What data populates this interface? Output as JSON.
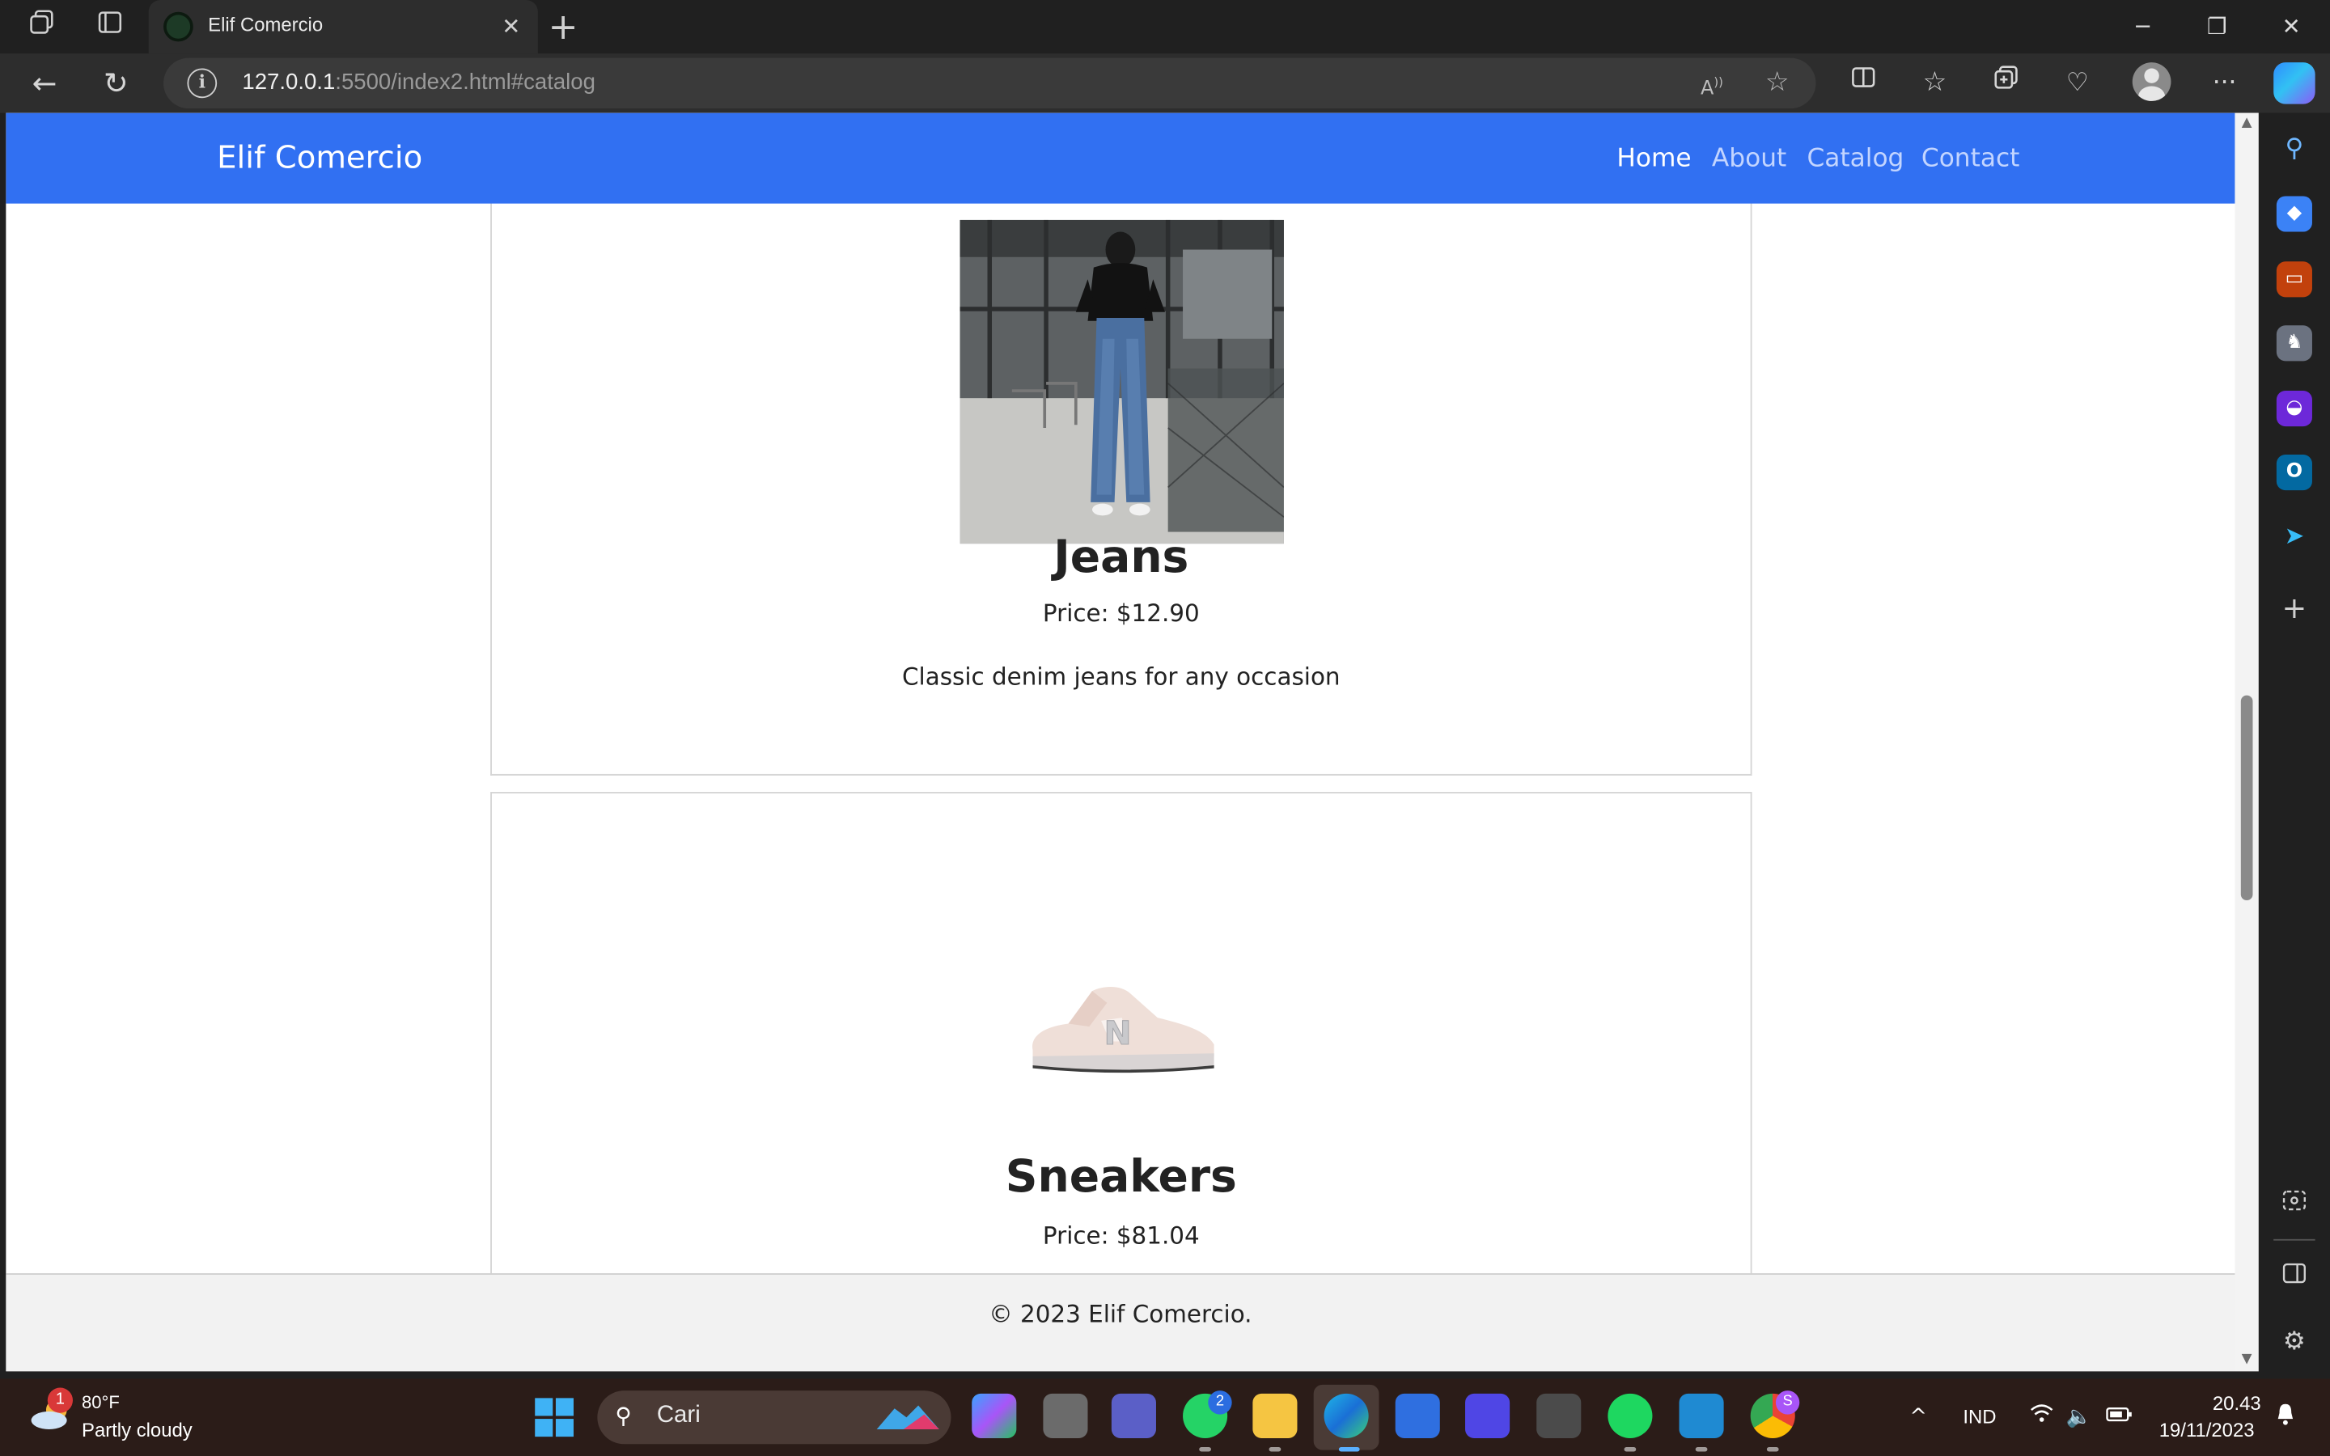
{
  "browser": {
    "tab_title": "Elif Comercio",
    "tab_close_icon": "✕",
    "new_tab_icon": "+",
    "url_host": "127.0.0.1",
    "url_rest": ":5500/index2.html#catalog",
    "window_controls": {
      "minimize": "─",
      "restore": "❐",
      "close": "✕"
    },
    "toolbar_icons": {
      "back": "←",
      "refresh": "↻",
      "info": "i",
      "more": "···"
    }
  },
  "site": {
    "brand": "Elif Comercio",
    "nav": [
      "Home",
      "About",
      "Catalog",
      "Contact"
    ],
    "active_nav": "Home",
    "products": [
      {
        "name": "Jeans",
        "price": "Price: $12.90",
        "description": "Classic denim jeans for any occasion"
      },
      {
        "name": "Sneakers",
        "price": "Price: $81.04"
      }
    ],
    "footer": "© 2023 Elif Comercio."
  },
  "taskbar": {
    "weather_badge": "1",
    "weather_temp": "80°F",
    "weather_condition": "Partly cloudy",
    "search_placeholder": "Cari",
    "whatsapp_badge": "2",
    "chrome_badge": "S",
    "language": "IND",
    "time": "20.43",
    "date": "19/11/2023",
    "tray_chevron": "^"
  },
  "colors": {
    "navbar": "#3170f2",
    "browser_chrome": "#202020",
    "taskbar": "#2b1c18"
  }
}
